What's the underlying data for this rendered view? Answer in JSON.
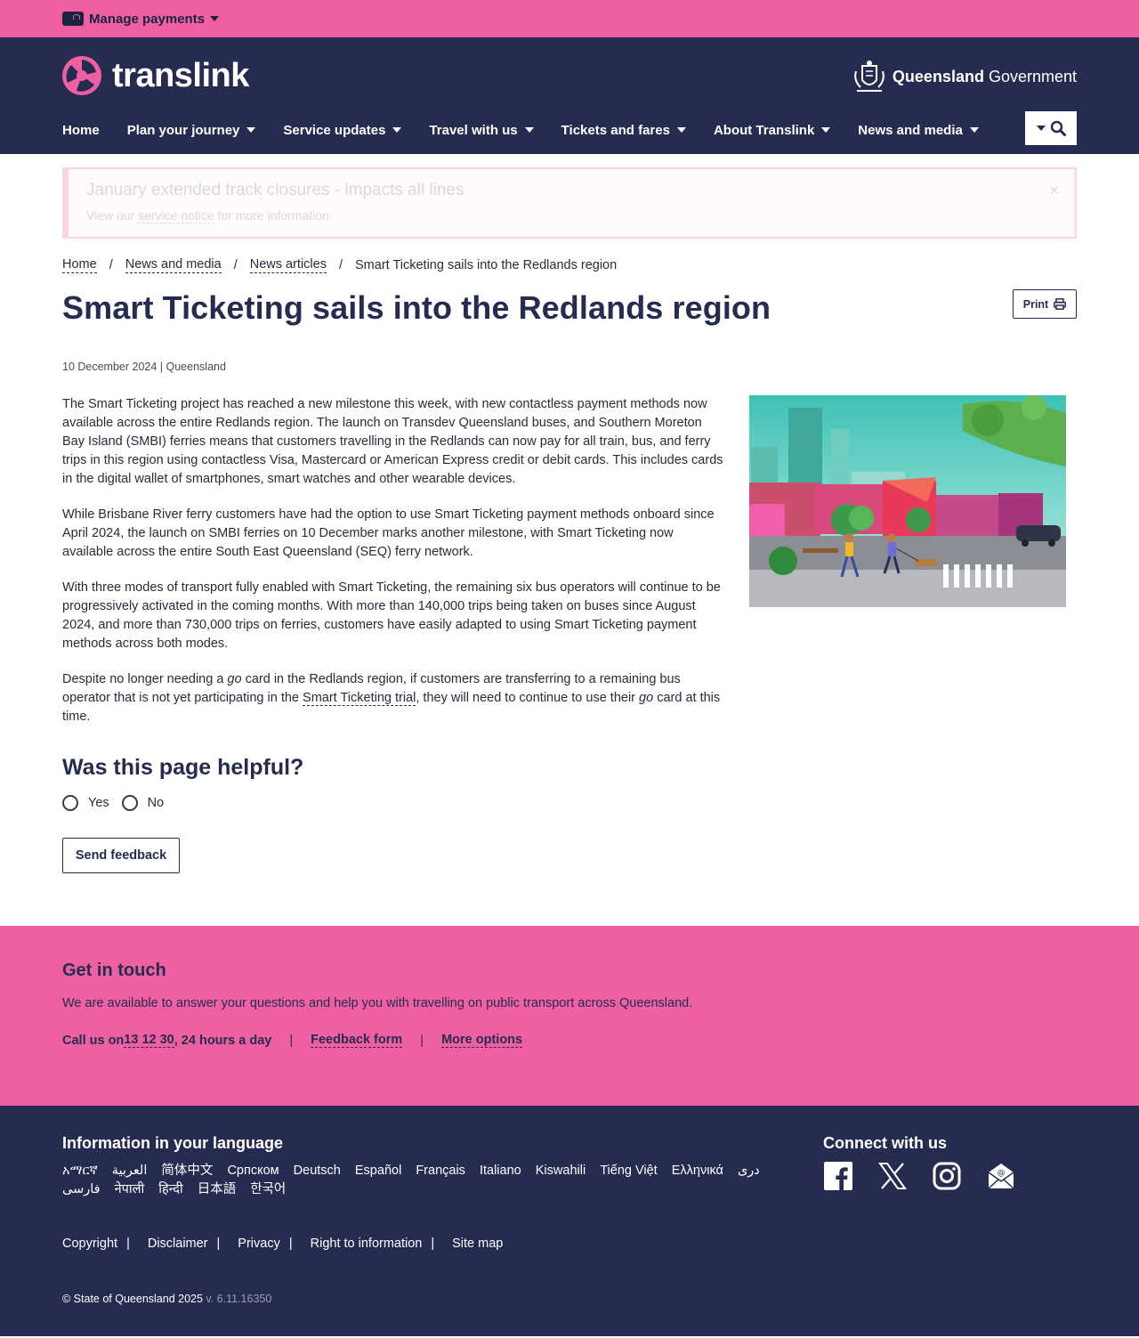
{
  "topbar": {
    "manage_payments": "Manage payments"
  },
  "header": {
    "logo_text": "translink",
    "gov_bold": "Queensland",
    "gov_rest": " Government",
    "nav": [
      {
        "label": "Home"
      },
      {
        "label": "Plan your journey"
      },
      {
        "label": "Service updates"
      },
      {
        "label": "Travel with us"
      },
      {
        "label": "Tickets and fares"
      },
      {
        "label": "About Translink"
      },
      {
        "label": "News and media"
      }
    ]
  },
  "alert": {
    "title": "January extended track closures - impacts all lines",
    "text_prefix": "View our ",
    "link": "service notice",
    "text_suffix": " for more information.",
    "close": "×"
  },
  "breadcrumb": [
    "Home",
    "News and media",
    "News articles",
    "Smart Ticketing sails into the Redlands region"
  ],
  "page": {
    "title": "Smart Ticketing sails into the Redlands region",
    "print_label": "Print",
    "meta": "10 December 2024 | Queensland"
  },
  "article": {
    "p1": "The Smart Ticketing project has reached a new milestone this week, with new contactless payment methods now available across the entire Redlands region. The launch on Transdev Queensland buses, and Southern Moreton Bay Island (SMBI) ferries means that customers travelling in the Redlands can now pay for all train, bus, and ferry trips in this region using contactless Visa, Mastercard or American Express credit or debit cards. This includes cards in the digital wallet of smartphones, smart watches and other wearable devices.",
    "p2": "While Brisbane River ferry customers have had the option to use Smart Ticketing payment methods onboard since April 2024, the launch on SMBI ferries on 10 December marks another milestone, with Smart Ticketing now available across the entire South East Queensland (SEQ) ferry network.",
    "p3": "With three modes of transport fully enabled with Smart Ticketing, the remaining six bus operators will continue to be progressively activated in the coming months. With more than 140,000 trips being taken on buses since August 2024, and more than 730,000 trips on ferries, customers have easily adapted to using Smart Ticketing payment methods across both modes.",
    "p4_a": "Despite no longer needing a ",
    "p4_go1": "go",
    "p4_b": " card in the Redlands region, if customers are transferring to a remaining bus operator that is not yet participating in the ",
    "p4_link": "Smart Ticketing trial",
    "p4_c": ", they will need to continue to use their ",
    "p4_go2": "go",
    "p4_d": " card at this time."
  },
  "feedback": {
    "title": "Was this page helpful?",
    "yes": "Yes",
    "no": "No",
    "send": "Send feedback"
  },
  "touch": {
    "title": "Get in touch",
    "desc": "We are available to answer your questions and help you with travelling on public transport across Queensland.",
    "call_prefix": "Call us on ",
    "phone": "13 12 30",
    "call_suffix": ", 24 hours a day",
    "sep": "|",
    "feedback_form": "Feedback form",
    "more_options": "More options"
  },
  "footer": {
    "lang_title": "Information in your language",
    "languages": [
      "አማርኛ",
      "العربية",
      "简体中文",
      "Српском",
      "Deutsch",
      "Español",
      "Français",
      "Italiano",
      "Kiswahili",
      "Tiếng Việt",
      "Ελληνικά",
      "دری",
      "فارسی",
      "नेपाली",
      "हिन्दी",
      "日本語",
      "한국어"
    ],
    "connect_title": "Connect with us",
    "legal": [
      "Copyright",
      "Disclaimer",
      "Privacy",
      "Right to information",
      "Site map"
    ],
    "copyright": "© State of Queensland 2025",
    "version": " v. 6.11.16350"
  },
  "colors": {
    "pink": "#ef60a3",
    "navy": "#262c4f"
  },
  "icons": [
    "card-icon",
    "translink-logo-icon",
    "qld-crest-icon",
    "search-icon",
    "printer-icon",
    "close-icon",
    "facebook-icon",
    "x-icon",
    "instagram-icon",
    "email-icon"
  ]
}
